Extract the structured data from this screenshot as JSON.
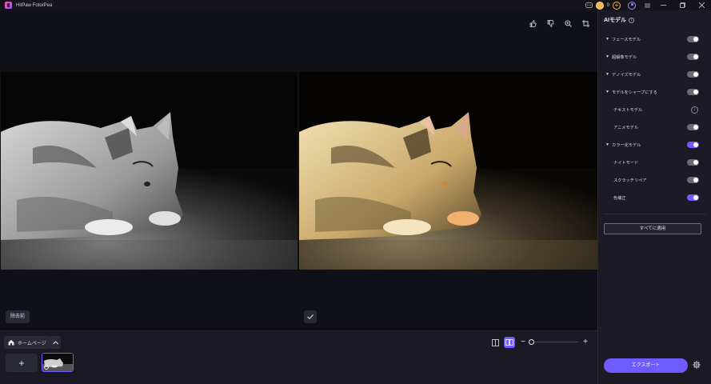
{
  "app": {
    "title": "HitPaw FotorPea"
  },
  "titlebar": {
    "coins": "0"
  },
  "canvas": {
    "before_label": "除去前"
  },
  "bottom": {
    "home_label": "ホームページ"
  },
  "panel": {
    "title": "AIモデル",
    "models": [
      {
        "label": "フェースモデル",
        "type": "group",
        "state": "off"
      },
      {
        "label": "超解像モデル",
        "type": "group",
        "state": "off"
      },
      {
        "label": "デノイズモデル",
        "type": "group",
        "state": "off"
      },
      {
        "label": "モデルをシャープにする",
        "type": "group",
        "state": "off"
      },
      {
        "label": "テキストモデル",
        "type": "sub",
        "state": "download"
      },
      {
        "label": "アニメモデル",
        "type": "sub",
        "state": "off"
      },
      {
        "label": "カラー化モデル",
        "type": "group",
        "state": "on"
      },
      {
        "label": "ナイトモード",
        "type": "sub",
        "state": "off"
      },
      {
        "label": "スクラッチリペア",
        "type": "sub",
        "state": "off"
      },
      {
        "label": "色補正",
        "type": "sub",
        "state": "on"
      }
    ],
    "apply_all_label": "すべてに適用",
    "export_label": "エクスポート"
  },
  "colors": {
    "accent": "#6e5cff",
    "panel_bg": "#1c1b25",
    "canvas_bg": "#101018"
  }
}
